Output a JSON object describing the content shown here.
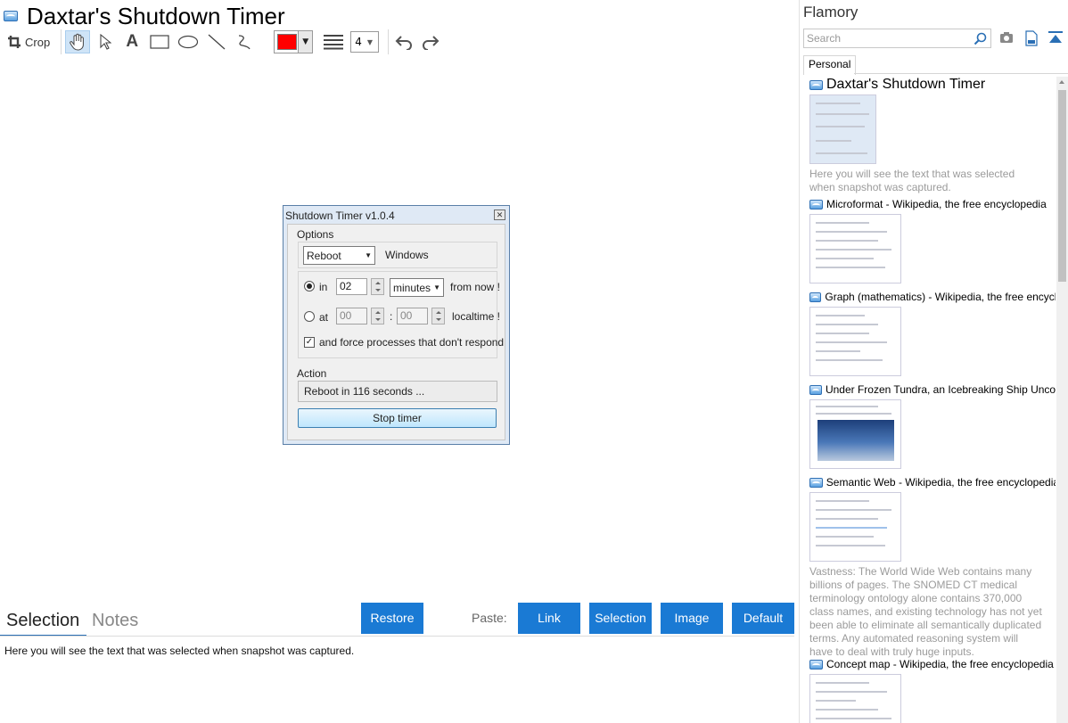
{
  "window": {
    "title": "Daxtar's Shutdown Timer"
  },
  "toolbar": {
    "crop_label": "Crop",
    "text_tool": "A",
    "pen_color": "#ff0000",
    "line_width": "4"
  },
  "dialog": {
    "title": "Shutdown Timer v1.0.4",
    "options_label": "Options",
    "mode": "Reboot",
    "os": "Windows",
    "in_label": "in",
    "in_value": "02",
    "unit": "minutes",
    "from_now": "from now !",
    "at_label": "at",
    "at_hour": "00",
    "at_colon": ":",
    "at_min": "00",
    "localtime": "localtime !",
    "force_label": "and force processes that don't respond",
    "force_mark": "✓",
    "action_label": "Action",
    "status": "Reboot in 116 seconds ...",
    "stop_label": "Stop timer"
  },
  "bottom": {
    "tab_selection": "Selection",
    "tab_notes": "Notes",
    "restore": "Restore",
    "paste_label": "Paste:",
    "paste_link": "Link",
    "paste_selection": "Selection",
    "paste_image": "Image",
    "paste_default": "Default",
    "selection_text": "Here you will see the text that was selected when snapshot was captured."
  },
  "side": {
    "title": "Flamory",
    "search_placeholder": "Search",
    "tab": "Personal",
    "items": [
      {
        "title": "Daxtar's Shutdown Timer",
        "desc": "Here you will see the text that was selected when snapshot was captured."
      },
      {
        "title": "Microformat - Wikipedia, the free encyclopedia",
        "desc": ""
      },
      {
        "title": "Graph (mathematics) - Wikipedia, the free encyclopedia",
        "desc": ""
      },
      {
        "title": "Under Frozen Tundra, an Icebreaking Ship Uncovers",
        "desc": ""
      },
      {
        "title": "Semantic Web - Wikipedia, the free encyclopedia",
        "desc": "Vastness: The World Wide Web contains many billions of pages. The SNOMED CT medical terminology ontology alone contains 370,000 class names, and existing technology has not yet been able to eliminate all semantically duplicated terms. Any automated reasoning system will have to deal with truly huge inputs."
      },
      {
        "title": "Concept map - Wikipedia, the free encyclopedia",
        "desc": ""
      }
    ]
  },
  "colors": {
    "accent": "#1a7ad4",
    "tab_underline": "#2a6fb5"
  }
}
